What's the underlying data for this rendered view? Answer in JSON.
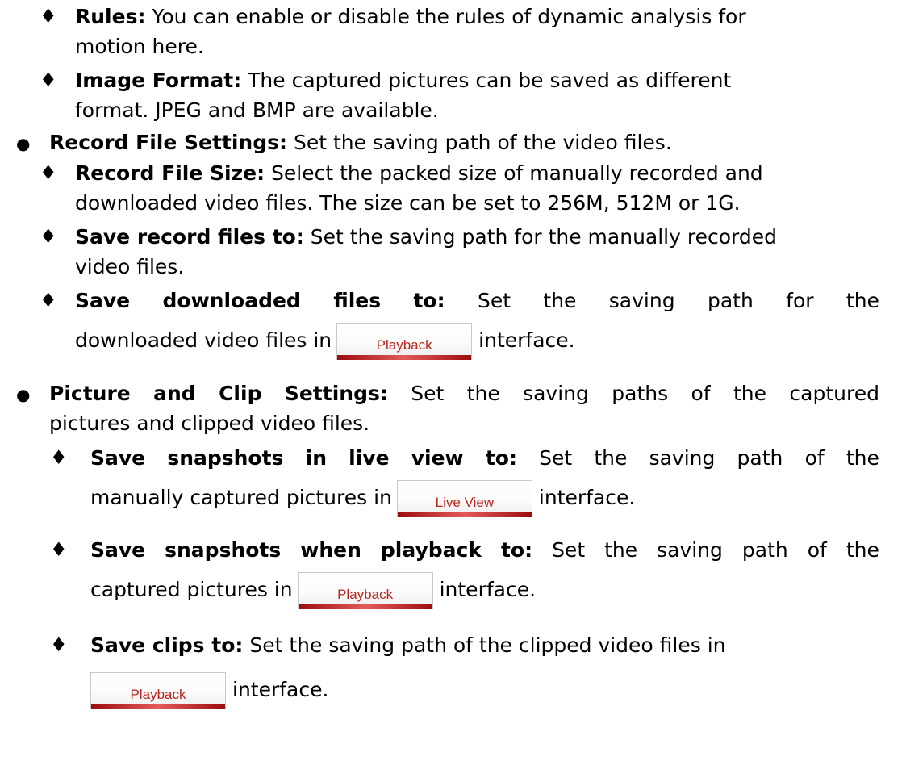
{
  "items": {
    "rules": {
      "label": "Rules:",
      "text1": " You can enable or disable the rules of dynamic analysis for",
      "text2": "motion here."
    },
    "image_format": {
      "label": "Image Format:",
      "text1": " The captured pictures can be saved as different",
      "text2": "format. JPEG and BMP are available."
    },
    "record_file_settings": {
      "label": "Record File Settings:",
      "text": " Set the saving path of the video files."
    },
    "record_file_size": {
      "label": "Record File Size:",
      "text1": " Select the packed size of manually recorded and",
      "text2": "downloaded video files. The size can be set to 256M, 512M or 1G."
    },
    "save_record_files": {
      "label": "Save record files to:",
      "text1": " Set the saving path for the manually recorded",
      "text2": "video files."
    },
    "save_downloaded_files": {
      "w1": "Save",
      "w2": "downloaded",
      "w3": "files",
      "w4": "to:",
      "w5": "Set",
      "w6": "the",
      "w7": "saving",
      "w8": "path",
      "w9": "for",
      "w10": "the",
      "text2": "downloaded video files in",
      "button": "Playback",
      "text3": "interface."
    },
    "picture_clip_settings": {
      "w1": "Picture",
      "w2": "and",
      "w3": "Clip",
      "w4": "Settings:",
      "w5": "Set",
      "w6": "the",
      "w7": "saving",
      "w8": "paths",
      "w9": "of",
      "w10": "the",
      "w11": "captured",
      "text2": "pictures and clipped video files."
    },
    "save_snapshots_live": {
      "w1": "Save",
      "w2": "snapshots",
      "w3": "in",
      "w4": "live",
      "w5": "view",
      "w6": "to:",
      "w7": "Set",
      "w8": "the",
      "w9": "saving",
      "w10": "path",
      "w11": "of",
      "w12": "the",
      "text2": "manually captured pictures in",
      "button": "Live View",
      "text3": "interface."
    },
    "save_snapshots_playback": {
      "w1": "Save",
      "w2": "snapshots",
      "w3": "when",
      "w4": "playback",
      "w5": "to:",
      "w6": "Set",
      "w7": "the",
      "w8": "saving",
      "w9": "path",
      "w10": "of",
      "w11": "the",
      "text2": "captured pictures in",
      "button": "Playback",
      "text3": "interface."
    },
    "save_clips": {
      "label": "Save clips to:",
      "text1": " Set the saving path of the clipped video files in",
      "button": "Playback",
      "text3": "interface."
    }
  },
  "bullets": {
    "diamond": "♦",
    "dot": "●"
  }
}
